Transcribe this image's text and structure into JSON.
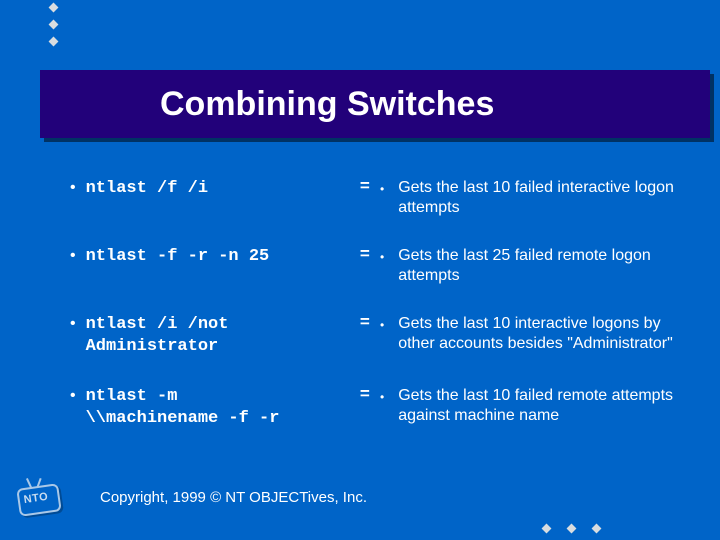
{
  "title": "Combining Switches",
  "rows": [
    {
      "cmd": "ntlast /f /i",
      "eq": "=",
      "desc": "Gets the last 10 failed interactive logon attempts"
    },
    {
      "cmd": "ntlast -f -r -n 25",
      "eq": "=",
      "desc": "Gets the last 25 failed remote logon attempts"
    },
    {
      "cmd": "ntlast /i /not\nAdministrator",
      "eq": "=",
      "desc": "Gets the last 10 interactive logons by other accounts besides \"Administrator\""
    },
    {
      "cmd": "ntlast -m\n\\\\machinename -f -r",
      "eq": "=",
      "desc": "Gets the last 10 failed remote attempts against machine name"
    }
  ],
  "logo_text": "NTO",
  "copyright": "Copyright, 1999 © NT OBJECTives, Inc."
}
